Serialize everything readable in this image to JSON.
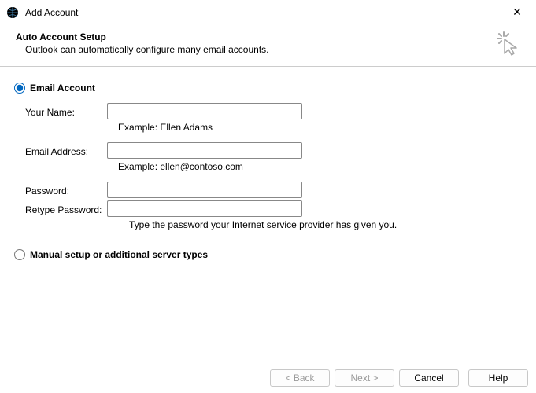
{
  "window": {
    "title": "Add Account",
    "close_glyph": "✕"
  },
  "header": {
    "heading": "Auto Account Setup",
    "subheading": "Outlook can automatically configure many email accounts."
  },
  "radios": {
    "email_account_label": "Email Account",
    "manual_setup_label": "Manual setup or additional server types"
  },
  "form": {
    "your_name": {
      "label": "Your Name:",
      "value": "",
      "example": "Example: Ellen Adams"
    },
    "email": {
      "label": "Email Address:",
      "value": "",
      "example": "Example: ellen@contoso.com"
    },
    "password": {
      "label": "Password:",
      "value": ""
    },
    "retype_password": {
      "label": "Retype Password:",
      "value": ""
    },
    "password_hint": "Type the password your Internet service provider has given you."
  },
  "footer": {
    "back": "< Back",
    "next": "Next >",
    "cancel": "Cancel",
    "help": "Help"
  }
}
